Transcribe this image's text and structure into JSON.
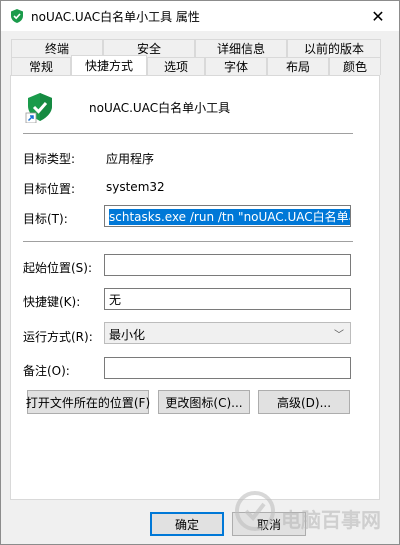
{
  "window": {
    "title": "noUAC.UAC白名单小工具 属性",
    "close_glyph": "✕"
  },
  "tabs": {
    "row1": [
      {
        "label": "终端"
      },
      {
        "label": "安全"
      },
      {
        "label": "详细信息"
      },
      {
        "label": "以前的版本"
      }
    ],
    "row2": [
      {
        "label": "常规"
      },
      {
        "label": "快捷方式",
        "active": true
      },
      {
        "label": "选项"
      },
      {
        "label": "字体"
      },
      {
        "label": "布局"
      },
      {
        "label": "颜色"
      }
    ]
  },
  "app": {
    "name": "noUAC.UAC白名单小工具",
    "icon": "shield-check-icon"
  },
  "fields": {
    "target_type_label": "目标类型:",
    "target_type_value": "应用程序",
    "target_location_label": "目标位置:",
    "target_location_value": "system32",
    "target_label": "目标(T):",
    "target_value": "schtasks.exe /run /tn \"noUAC.UAC白名单小工具\"",
    "start_in_label": "起始位置(S):",
    "start_in_value": "",
    "hotkey_label": "快捷键(K):",
    "hotkey_value": "无",
    "run_label": "运行方式(R):",
    "run_value": "最小化",
    "comment_label": "备注(O):",
    "comment_value": ""
  },
  "buttons": {
    "open_location": "打开文件所在的位置(F)",
    "change_icon": "更改图标(C)...",
    "advanced": "高级(D)...",
    "ok": "确定",
    "cancel": "取消"
  },
  "colors": {
    "accent": "#0078d7",
    "shield_green": "#1a9b4b"
  },
  "watermark": {
    "text": "电脑百事网"
  }
}
